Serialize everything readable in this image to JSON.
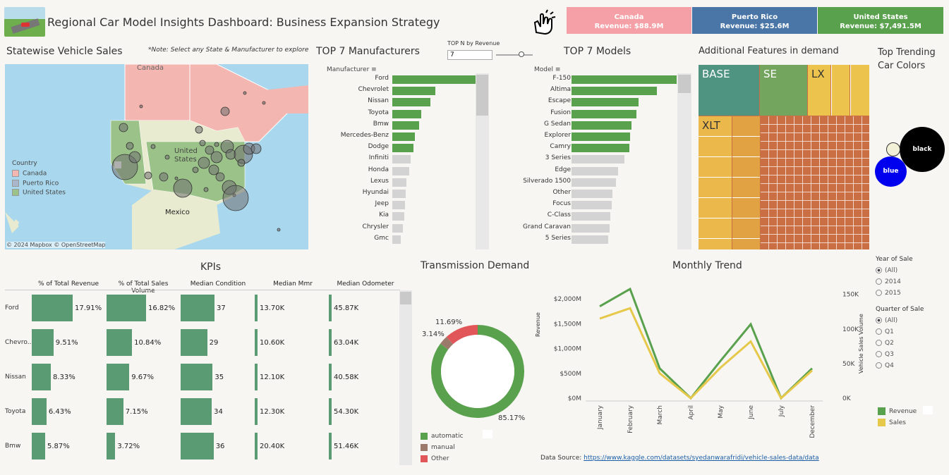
{
  "header": {
    "title": "Regional Car Model Insights Dashboard: Business Expansion Strategy",
    "cards": [
      {
        "name": "Canada",
        "revenue": "Revenue: $88.9M",
        "color": "#f4a0a6"
      },
      {
        "name": "Puerto Rico",
        "revenue": "Revenue: $25.6M",
        "color": "#4a75a7"
      },
      {
        "name": "United States",
        "revenue": "Revenue: $7,491.5M",
        "color": "#5aa14e"
      }
    ]
  },
  "map": {
    "title": "Statewise Vehicle Sales",
    "note": "*Note: Select any State & Manufacturer to explore",
    "labels": {
      "canada": "Canada",
      "us": "United States",
      "mexico": "Mexico"
    },
    "legend_title": "Country",
    "legend": [
      {
        "label": "Canada",
        "color": "#f4b6b0"
      },
      {
        "label": "Puerto Rico",
        "color": "#a9b6cc"
      },
      {
        "label": "United States",
        "color": "#9bc389"
      }
    ],
    "attribution": "© 2024 Mapbox  © OpenStreetMap"
  },
  "topn": {
    "label": "TOP N by Revenue",
    "value": "7"
  },
  "manufacturers": {
    "title": "TOP 7 Manufacturers",
    "header": "Manufacturer",
    "colors": {
      "top": "#5aa14e",
      "rest": "#d3d3d3"
    },
    "chart_data": {
      "type": "bar",
      "categories": [
        "Ford",
        "Chevrolet",
        "Nissan",
        "Toyota",
        "Bmw",
        "Mercedes-Benz",
        "Dodge",
        "Infiniti",
        "Honda",
        "Lexus",
        "Hyundai",
        "Jeep",
        "Kia",
        "Chrysler",
        "Gmc"
      ],
      "values": [
        100,
        52,
        46,
        35,
        32,
        27,
        25,
        22,
        20,
        17,
        16,
        15,
        14,
        13,
        10
      ],
      "highlight_count": 7
    }
  },
  "models": {
    "title": "TOP 7 Models",
    "header": "Model",
    "chart_data": {
      "type": "bar",
      "categories": [
        "F-150",
        "Altima",
        "Escape",
        "Fusion",
        "G Sedan",
        "Explorer",
        "Camry",
        "3 Series",
        "Edge",
        "Silverado 1500",
        "Other",
        "Focus",
        "C-Class",
        "Grand Caravan",
        "5 Series"
      ],
      "values": [
        100,
        81,
        64,
        62,
        57,
        56,
        55,
        50,
        44,
        42,
        39,
        38,
        37,
        36,
        35
      ],
      "highlight_count": 7
    }
  },
  "features": {
    "title": "Additional Features in demand",
    "tiles": [
      "BASE",
      "SE",
      "LX",
      "XLT"
    ]
  },
  "colors_panel": {
    "title": "Top Trending Car Colors",
    "bubbles": [
      {
        "label": "black",
        "color": "#000000"
      },
      {
        "label": "blue",
        "color": "#0000ee"
      },
      {
        "label": "",
        "color": "#f3f0d8"
      }
    ]
  },
  "kpis": {
    "title": "KPIs",
    "columns": [
      "% of Total Revenue",
      "% of Total Sales Volume",
      "Median Condition",
      "Median Mmr",
      "Median Odometer"
    ],
    "rows": [
      {
        "name": "Ford",
        "rev": "17.91%",
        "vol": "16.82%",
        "cond": "37",
        "mmr": "13.70K",
        "odo": "45.87K"
      },
      {
        "name": "Chevro..",
        "rev": "9.51%",
        "vol": "10.84%",
        "cond": "29",
        "mmr": "10.60K",
        "odo": "63.04K"
      },
      {
        "name": "Nissan",
        "rev": "8.33%",
        "vol": "9.67%",
        "cond": "35",
        "mmr": "12.10K",
        "odo": "40.58K"
      },
      {
        "name": "Toyota",
        "rev": "6.43%",
        "vol": "7.15%",
        "cond": "34",
        "mmr": "12.30K",
        "odo": "54.30K"
      },
      {
        "name": "Bmw",
        "rev": "5.87%",
        "vol": "3.72%",
        "cond": "36",
        "mmr": "20.40K",
        "odo": "51.46K"
      }
    ]
  },
  "transmission": {
    "title": "Transmission Demand",
    "chart_data": {
      "type": "pie",
      "categories": [
        "automatic",
        "manual",
        "Other"
      ],
      "values": [
        85.17,
        3.14,
        11.69
      ],
      "colors": [
        "#5aa14e",
        "#9c7a6b",
        "#e15759"
      ]
    },
    "labels": {
      "automatic": "85.17%",
      "manual": "3.14%",
      "other": "11.69%"
    }
  },
  "trend": {
    "title": "Monthly Trend",
    "ylabel": "Revenue",
    "y2label": "Vehicle Sales Volume",
    "yticks": [
      "$2,000M",
      "$1,500M",
      "$1,000M",
      "$500M",
      "$0M"
    ],
    "y2ticks": [
      "150K",
      "100K",
      "50K",
      "0K"
    ],
    "chart_data": {
      "type": "line",
      "x": [
        "January",
        "February",
        "March",
        "April",
        "May",
        "June",
        "July",
        "December"
      ],
      "series": [
        {
          "name": "Revenue",
          "values": [
            1850,
            2200,
            600,
            0,
            750,
            1490,
            0,
            600
          ],
          "color": "#5aa14e",
          "axis": "left"
        },
        {
          "name": "Sales",
          "values": [
            115,
            130,
            36,
            0,
            44,
            82,
            0,
            40
          ],
          "color": "#e6c84a",
          "axis": "right"
        }
      ],
      "ylim": [
        0,
        2300
      ],
      "y2lim": [
        0,
        165
      ]
    }
  },
  "filters": {
    "year_title": "Year of Sale",
    "years": [
      "(All)",
      "2014",
      "2015"
    ],
    "quarter_title": "Quarter of Sale",
    "quarters": [
      "(All)",
      "Q1",
      "Q2",
      "Q3",
      "Q4"
    ]
  },
  "footer": {
    "source_label": "Data Source:",
    "source_link": "https://www.kaggle.com/datasets/syedanwarafridi/vehicle-sales-data/data"
  }
}
